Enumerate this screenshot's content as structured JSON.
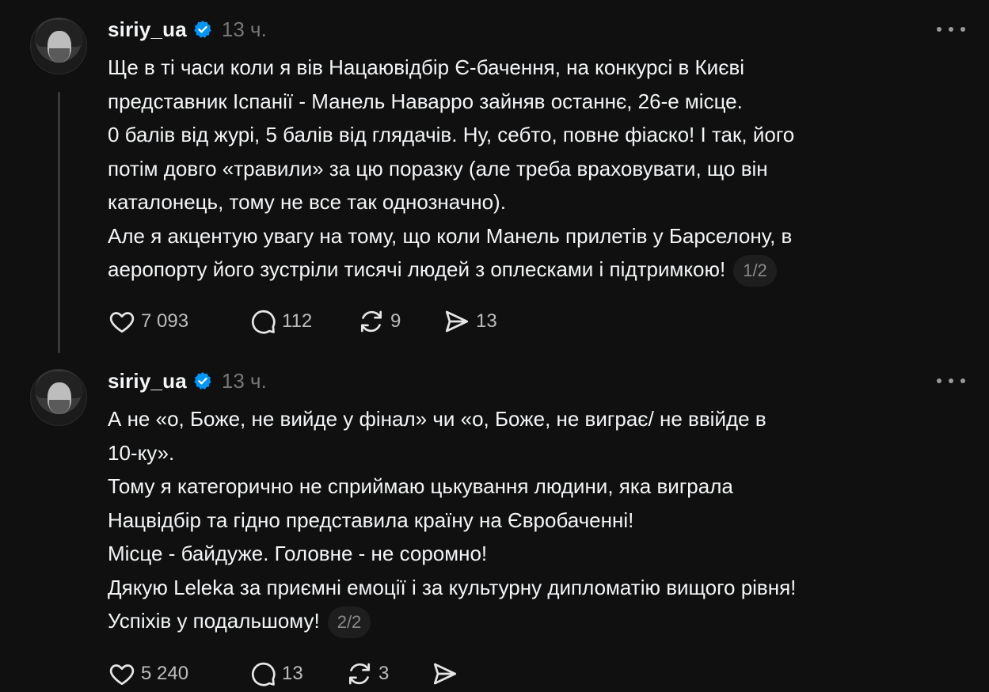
{
  "posts": [
    {
      "username": "siriy_ua",
      "time": "13 ч.",
      "lines": [
        "Ще в ті часи коли я вів Нацаювідбір Є-бачення, на конкурсі в Києві",
        "представник Іспанії - Манель Наварро зайняв останнє, 26-е місце.",
        "0 балів від журі, 5 балів від глядачів. Ну, себто, повне фіаско! І так, його",
        "потім довго «травили» за цю поразку (але треба враховувати, що він",
        "каталонець, тому не все так однозначно).",
        "Але я акцентую увагу на тому, що коли Манель прилетів у Барселону, в",
        "аеропорту його зустріли тисячі людей з оплесками і підтримкою!"
      ],
      "pager": "1/2",
      "likes": "7 093",
      "comments": "112",
      "reposts": "9",
      "shares": "13"
    },
    {
      "username": "siriy_ua",
      "time": "13 ч.",
      "lines": [
        "А не «о, Боже, не вийде у фінал» чи «о, Боже, не виграє/ не ввійде в",
        "10-ку».",
        "Тому я категорично не сприймаю цькування людини, яка виграла",
        "Нацвідбір та гідно представила країну на Євробаченні!",
        "Місце - байдуже. Головне - не соромно!",
        "Дякую Leleka за приємні емоції і за культурну дипломатію вищого рівня!",
        "Успіхів у подальшому!"
      ],
      "pager": "2/2",
      "likes": "5 240",
      "comments": "13",
      "reposts": "3",
      "shares": ""
    }
  ],
  "icons": {
    "verified": "verified-badge-icon",
    "more": "more-options-icon",
    "like": "heart-icon",
    "comment": "comment-bubble-icon",
    "repost": "repost-icon",
    "share": "share-send-icon"
  },
  "colors": {
    "background": "#101010",
    "text": "#f3f5f7",
    "muted": "#777777",
    "verified": "#0095f6"
  }
}
